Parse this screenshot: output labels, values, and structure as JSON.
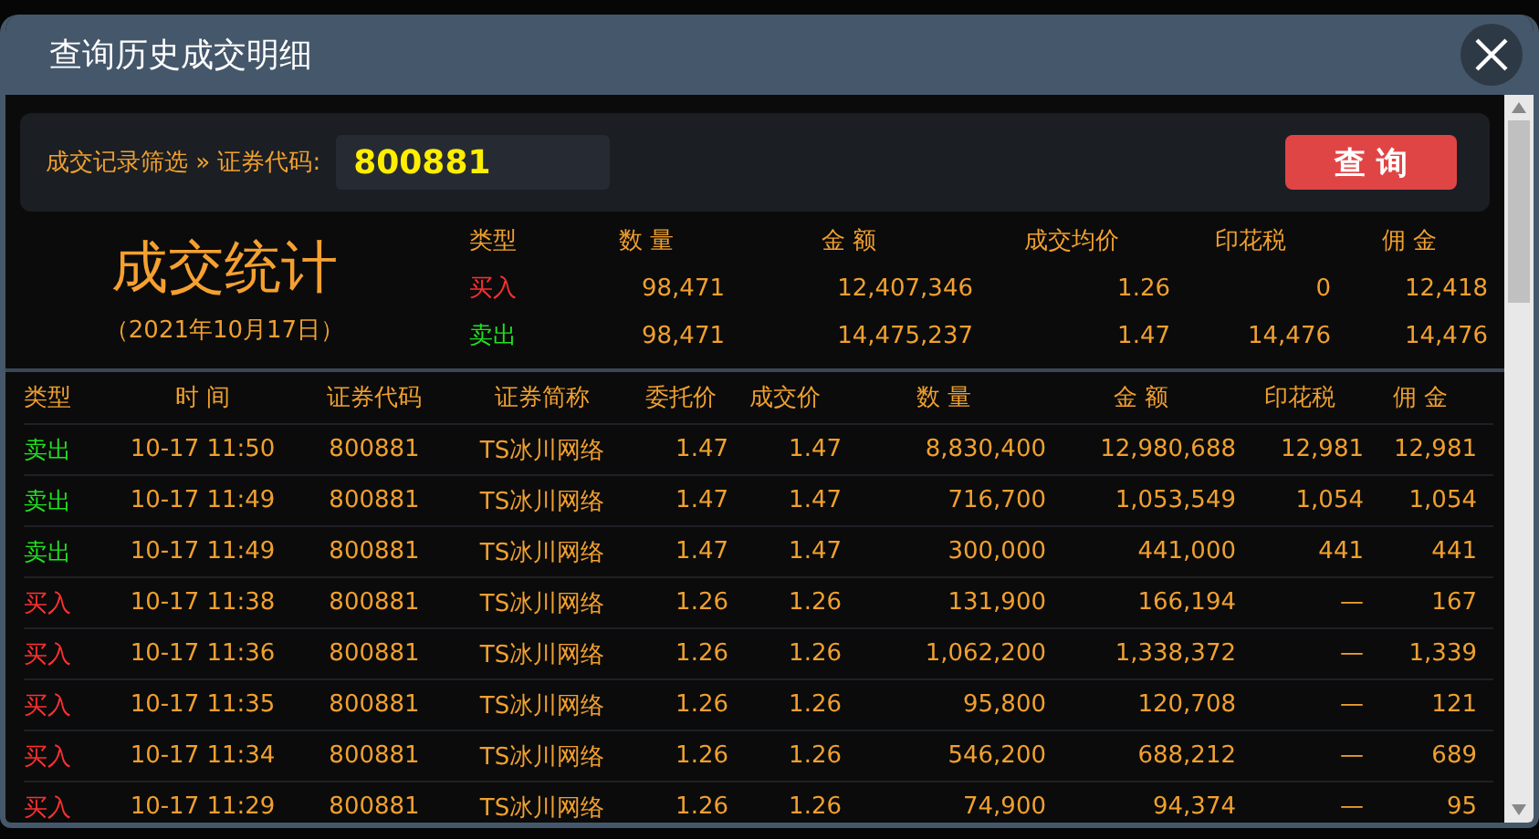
{
  "window": {
    "title": "查询历史成交明细"
  },
  "filter": {
    "label": "成交记录筛选 » 证券代码:",
    "code": "800881",
    "button": "查 询"
  },
  "summary": {
    "title": "成交统计",
    "date": "（2021年10月17日）",
    "columns": [
      "类型",
      "数 量",
      "金 额",
      "成交均价",
      "印花税",
      "佣 金"
    ],
    "rows": [
      {
        "kind": "buy",
        "cells": [
          "买入",
          "98,471",
          "12,407,346",
          "1.26",
          "0",
          "12,418"
        ]
      },
      {
        "kind": "sell",
        "cells": [
          "卖出",
          "98,471",
          "14,475,237",
          "1.47",
          "14,476",
          "14,476"
        ]
      }
    ]
  },
  "table": {
    "columns": [
      "类型",
      "时 间",
      "证券代码",
      "证券简称",
      "委托价",
      "成交价",
      "数 量",
      "金 额",
      "印花税",
      "佣 金"
    ],
    "rows": [
      {
        "kind": "sell",
        "cells": [
          "卖出",
          "10-17 11:50",
          "800881",
          "TS冰川网络",
          "1.47",
          "1.47",
          "8,830,400",
          "12,980,688",
          "12,981",
          "12,981"
        ]
      },
      {
        "kind": "sell",
        "cells": [
          "卖出",
          "10-17 11:49",
          "800881",
          "TS冰川网络",
          "1.47",
          "1.47",
          "716,700",
          "1,053,549",
          "1,054",
          "1,054"
        ]
      },
      {
        "kind": "sell",
        "cells": [
          "卖出",
          "10-17 11:49",
          "800881",
          "TS冰川网络",
          "1.47",
          "1.47",
          "300,000",
          "441,000",
          "441",
          "441"
        ]
      },
      {
        "kind": "buy",
        "cells": [
          "买入",
          "10-17 11:38",
          "800881",
          "TS冰川网络",
          "1.26",
          "1.26",
          "131,900",
          "166,194",
          "—",
          "167"
        ]
      },
      {
        "kind": "buy",
        "cells": [
          "买入",
          "10-17 11:36",
          "800881",
          "TS冰川网络",
          "1.26",
          "1.26",
          "1,062,200",
          "1,338,372",
          "—",
          "1,339"
        ]
      },
      {
        "kind": "buy",
        "cells": [
          "买入",
          "10-17 11:35",
          "800881",
          "TS冰川网络",
          "1.26",
          "1.26",
          "95,800",
          "120,708",
          "—",
          "121"
        ]
      },
      {
        "kind": "buy",
        "cells": [
          "买入",
          "10-17 11:34",
          "800881",
          "TS冰川网络",
          "1.26",
          "1.26",
          "546,200",
          "688,212",
          "—",
          "689"
        ]
      },
      {
        "kind": "buy",
        "cells": [
          "买入",
          "10-17 11:29",
          "800881",
          "TS冰川网络",
          "1.26",
          "1.26",
          "74,900",
          "94,374",
          "—",
          "95"
        ]
      }
    ]
  }
}
